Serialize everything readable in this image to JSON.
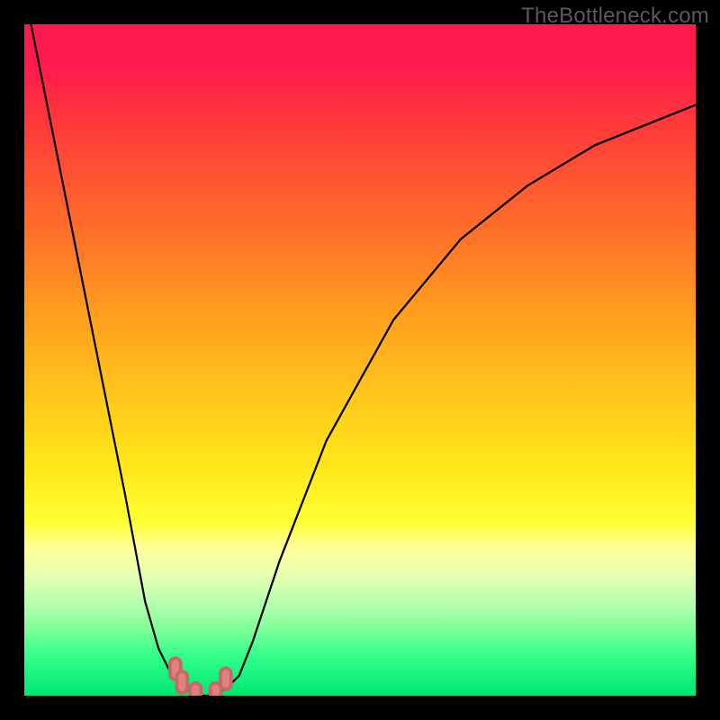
{
  "watermark": "TheBottleneck.com",
  "chart_data": {
    "type": "line",
    "title": "",
    "xlabel": "",
    "ylabel": "",
    "xlim": [
      0,
      100
    ],
    "ylim": [
      0,
      100
    ],
    "series": [
      {
        "name": "bottleneck-curve",
        "x": [
          1,
          5,
          10,
          15,
          18,
          20,
          22,
          24,
          26,
          27,
          28,
          30,
          32,
          34,
          38,
          45,
          55,
          65,
          75,
          85,
          95,
          100
        ],
        "y": [
          100,
          80,
          55,
          30,
          14,
          7,
          3,
          1,
          0,
          0,
          0,
          1,
          3,
          8,
          20,
          38,
          56,
          68,
          76,
          82,
          86,
          88
        ]
      }
    ],
    "markers": {
      "name": "highlight-points",
      "x": [
        22.5,
        23.5,
        25.5,
        28.5,
        30.0
      ],
      "y": [
        4.0,
        2.0,
        0.3,
        0.3,
        2.5
      ]
    },
    "background_gradient": {
      "top": "#ff1a4d",
      "mid": "#ffe81a",
      "bottom": "#00e673"
    }
  }
}
